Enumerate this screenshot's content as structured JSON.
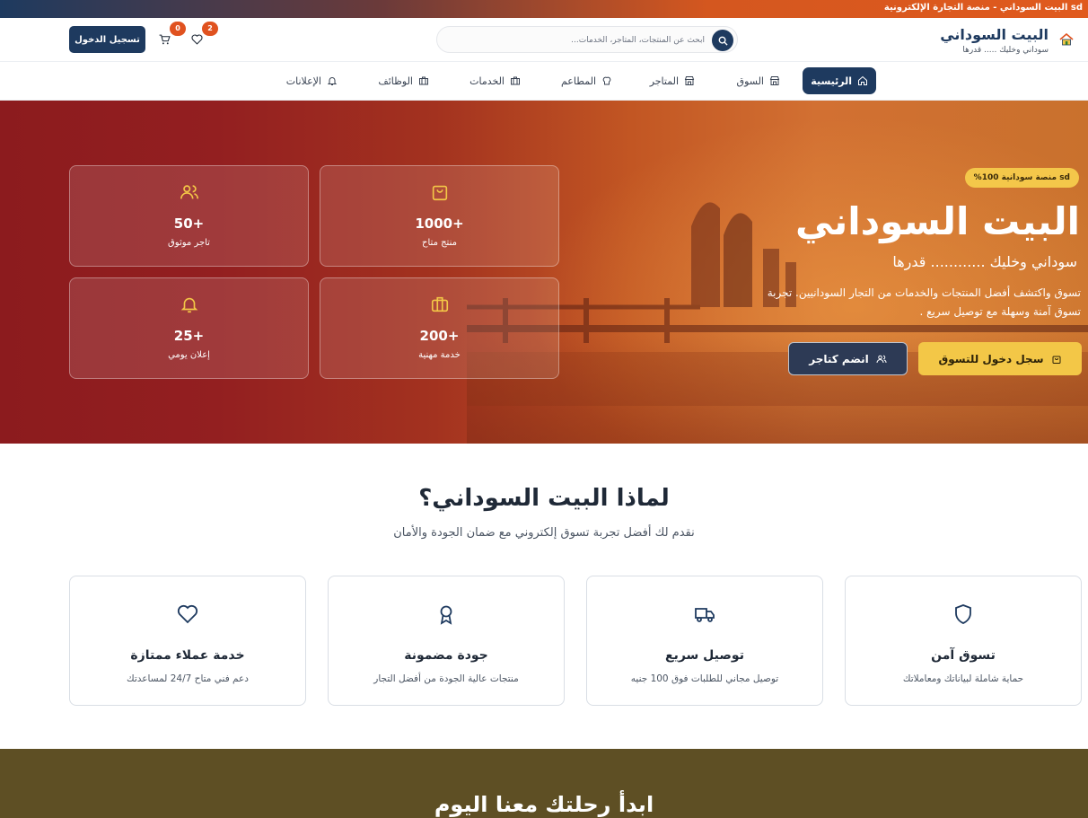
{
  "topbar": {
    "text": "sd البيت السوداني - منصة التجارة الإلكترونية"
  },
  "header": {
    "brand_title": "البيت السوداني",
    "brand_subtitle": "سوداني وخليك ..... قدرها",
    "search_placeholder": "ابحث عن المنتجات، المتاجر، الخدمات...",
    "cart_count": "0",
    "wishlist_count": "2",
    "login_label": "تسجيل الدخول"
  },
  "nav": {
    "items": [
      {
        "label": "الرئيسية",
        "icon": "home-icon",
        "active": true
      },
      {
        "label": "السوق",
        "icon": "store-icon"
      },
      {
        "label": "المتاجر",
        "icon": "shop-icon"
      },
      {
        "label": "المطاعم",
        "icon": "chef-hat-icon"
      },
      {
        "label": "الخدمات",
        "icon": "building-icon"
      },
      {
        "label": "الوظائف",
        "icon": "building-icon"
      },
      {
        "label": "الإعلانات",
        "icon": "bell-icon"
      }
    ]
  },
  "hero": {
    "tag": "sd منصة سودانية 100%",
    "title": "البيت السوداني",
    "subtitle": "سوداني وخليك ............ قدرها",
    "description": "تسوق واكتشف أفضل المنتجات والخدمات من التجار السودانيين. تجربة تسوق آمنة وسهلة مع توصيل سريع .",
    "primary_cta": "سجل دخول للتسوق",
    "secondary_cta": "انضم كتاجر",
    "stats": [
      {
        "value": "+1000",
        "label": "منتج متاح",
        "icon": "shopping-bag-icon"
      },
      {
        "value": "+50",
        "label": "تاجر موثوق",
        "icon": "users-icon"
      },
      {
        "value": "+200",
        "label": "خدمة مهنية",
        "icon": "briefcase-icon"
      },
      {
        "value": "+25",
        "label": "إعلان يومي",
        "icon": "bell-icon"
      }
    ]
  },
  "why": {
    "title": "لماذا البيت السوداني؟",
    "subtitle": "نقدم لك أفضل تجربة تسوق إلكتروني مع ضمان الجودة والأمان",
    "features": [
      {
        "title": "تسوق آمن",
        "desc": "حماية شاملة لبياناتك ومعاملاتك",
        "icon": "shield-icon"
      },
      {
        "title": "توصيل سريع",
        "desc": "توصيل مجاني للطلبات فوق 100 جنيه",
        "icon": "truck-icon"
      },
      {
        "title": "جودة مضمونة",
        "desc": "منتجات عالية الجودة من أفضل التجار",
        "icon": "award-icon"
      },
      {
        "title": "خدمة عملاء ممتازة",
        "desc": "دعم فني متاح 24/7 لمساعدتك",
        "icon": "heart-icon"
      }
    ]
  },
  "cta": {
    "title": "ابدأ رحلتك معنا اليوم"
  },
  "colors": {
    "primary": "#1e3a5f",
    "accent": "#f3c747",
    "badge": "#e0521f",
    "cta_bg": "#5e4f24"
  }
}
